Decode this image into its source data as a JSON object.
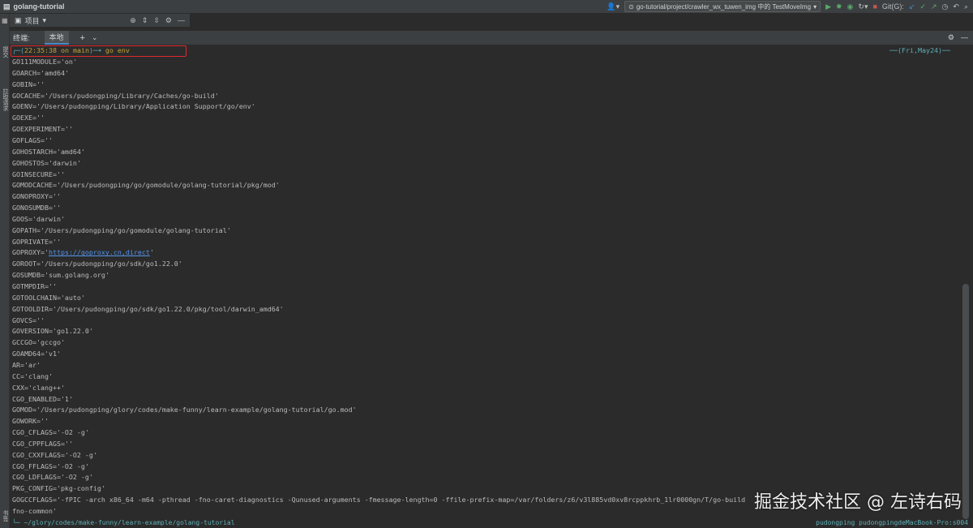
{
  "title": "golang-tutorial",
  "run_config": "go-tutorial/project/crawler_wx_tuwen_img 中的 TestMoveImg",
  "git_label": "Git(G):",
  "toolbar": {
    "project_label": "项目"
  },
  "left_strip": {
    "top_label": "提交",
    "mid_label": "拉取请求",
    "bottom_label": "书签"
  },
  "terminal_header": {
    "label": "终端:",
    "tab": "本地",
    "add": "+",
    "dropdown": "⌄"
  },
  "prompt": {
    "time": "22:35:38",
    "branch_text": "on main",
    "command": "go env",
    "date": "Fri,May24"
  },
  "env_lines": [
    "GO111MODULE='on'",
    "GOARCH='amd64'",
    "GOBIN=''",
    "GOCACHE='/Users/pudongping/Library/Caches/go-build'",
    "GOENV='/Users/pudongping/Library/Application Support/go/env'",
    "GOEXE=''",
    "GOEXPERIMENT=''",
    "GOFLAGS=''",
    "GOHOSTARCH='amd64'",
    "GOHOSTOS='darwin'",
    "GOINSECURE=''",
    "GOMODCACHE='/Users/pudongping/go/gomodule/golang-tutorial/pkg/mod'",
    "GONOPROXY=''",
    "GONOSUMDB=''",
    "GOOS='darwin'",
    "GOPATH='/Users/pudongping/go/gomodule/golang-tutorial'",
    "GOPRIVATE=''",
    "GOPROXY='https://goproxy.cn,direct'",
    "GOROOT='/Users/pudongping/go/sdk/go1.22.0'",
    "GOSUMDB='sum.golang.org'",
    "GOTMPDIR=''",
    "GOTOOLCHAIN='auto'",
    "GOTOOLDIR='/Users/pudongping/go/sdk/go1.22.0/pkg/tool/darwin_amd64'",
    "GOVCS=''",
    "GOVERSION='go1.22.0'",
    "GCCGO='gccgo'",
    "GOAMD64='v1'",
    "AR='ar'",
    "CC='clang'",
    "CXX='clang++'",
    "CGO_ENABLED='1'",
    "GOMOD='/Users/pudongping/glory/codes/make-funny/learn-example/golang-tutorial/go.mod'",
    "GOWORK=''",
    "CGO_CFLAGS='-O2 -g'",
    "CGO_CPPFLAGS=''",
    "CGO_CXXFLAGS='-O2 -g'",
    "CGO_FFLAGS='-O2 -g'",
    "CGO_LDFLAGS='-O2 -g'",
    "PKG_CONFIG='pkg-config'",
    "GOGCCFLAGS='-fPIC -arch x86_64 -m64 -pthread -fno-caret-diagnostics -Qunused-arguments -fmessage-length=0 -ffile-prefix-map=/var/folders/z6/v3l885vd0xv8rcppkhrb_1lr0000gn/T/go-build",
    "fno-common'"
  ],
  "goproxy_prefix": "GOPROXY='",
  "goproxy_url": "https://goproxy.cn,direct",
  "goproxy_suffix": "'",
  "statusbar": {
    "path": "~/glory/codes/make-funny/learn-example/golang-tutorial",
    "host": "pudongping  pudongpingdeMacBook-Pro:s004"
  },
  "watermark": "掘金技术社区 @ 左诗右码",
  "colors": {
    "background": "#2b2b2b",
    "prompt": "#5fb0b7",
    "highlight_box": "#e0282e",
    "url": "#5394ec"
  }
}
